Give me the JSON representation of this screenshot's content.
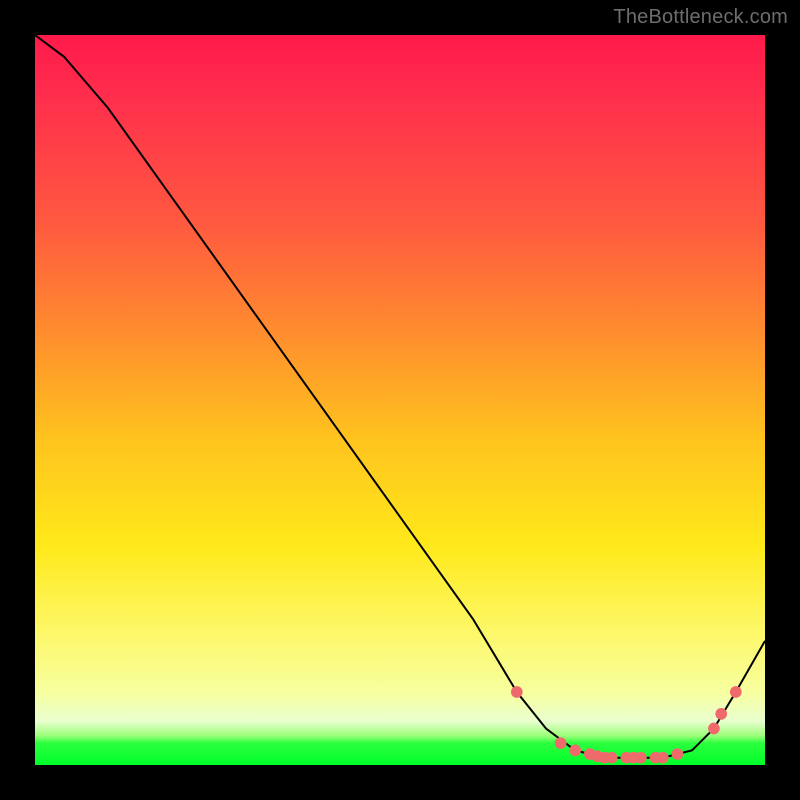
{
  "watermark": "TheBottleneck.com",
  "chart_data": {
    "type": "line",
    "title": "",
    "xlabel": "",
    "ylabel": "",
    "xlim": [
      0,
      100
    ],
    "ylim": [
      0,
      100
    ],
    "grid": false,
    "legend": false,
    "series": [
      {
        "name": "curve",
        "x": [
          0,
          4,
          10,
          20,
          30,
          40,
          50,
          60,
          66,
          70,
          74,
          78,
          82,
          86,
          90,
          93,
          96,
          100
        ],
        "y": [
          100,
          97,
          90,
          76,
          62,
          48,
          34,
          20,
          10,
          5,
          2,
          1,
          1,
          1,
          2,
          5,
          10,
          17
        ]
      }
    ],
    "markers": {
      "name": "dots",
      "color": "#ef6b6b",
      "x": [
        66,
        72,
        74,
        76,
        77,
        78,
        79,
        81,
        82,
        83,
        85,
        86,
        88,
        93,
        94,
        96
      ],
      "y": [
        10,
        3,
        2,
        1.5,
        1.2,
        1,
        1,
        1,
        1,
        1,
        1,
        1,
        1.5,
        5,
        7,
        10
      ]
    }
  }
}
